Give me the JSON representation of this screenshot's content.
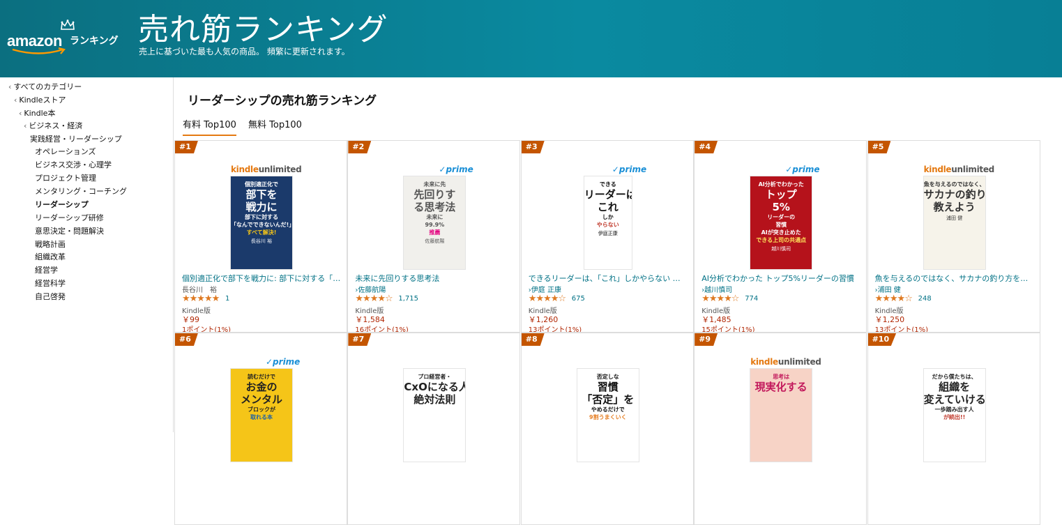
{
  "header": {
    "logo_brand": "amazon",
    "logo_label": "ランキング",
    "title": "売れ筋ランキング",
    "subtitle": "売上に基づいた最も人気の商品。 頻繁に更新されます。"
  },
  "sidebar": {
    "items": [
      {
        "label": "すべてのカテゴリー",
        "chev": "‹"
      },
      {
        "label": "Kindleストア",
        "chev": "‹"
      },
      {
        "label": "Kindle本",
        "chev": "‹"
      },
      {
        "label": "ビジネス・経済",
        "chev": "‹"
      },
      {
        "label": "実践経営・リーダーシップ"
      },
      {
        "label": "オペレーションズ"
      },
      {
        "label": "ビジネス交渉・心理学"
      },
      {
        "label": "プロジェクト管理"
      },
      {
        "label": "メンタリング・コーチング"
      },
      {
        "label": "リーダーシップ"
      },
      {
        "label": "リーダーシップ研修"
      },
      {
        "label": "意思決定・問題解決"
      },
      {
        "label": "戦略計画"
      },
      {
        "label": "組織改革"
      },
      {
        "label": "経営学"
      },
      {
        "label": "経営科学"
      },
      {
        "label": "自己啓発"
      }
    ]
  },
  "main": {
    "title": "リーダーシップの売れ筋ランキング",
    "tabs": [
      "有料 Top100",
      "無料 Top100"
    ]
  },
  "products": [
    {
      "rank": "#1",
      "badge": "kindleunlimited",
      "ku_k": "kindle",
      "ku_u": "unlimited",
      "title": "個別適正化で部下を戦力に: 部下に対する「なんでできないんだ!」すべて解決!",
      "author": "長谷川　裕",
      "stars": "★★★★★",
      "reviews": "1",
      "format": "Kindle版",
      "price": "￥99",
      "points": "1ポイント(1%)",
      "cover_text": [
        "個別適正化で",
        "部下を",
        "戦力に",
        "部下に対する",
        "「なんでできないんだ!」",
        "すべて解決!"
      ],
      "cover_author": "長谷川 裕"
    },
    {
      "rank": "#2",
      "badge": "prime",
      "prime": "✓prime",
      "title": "未来に先回りする思考法",
      "author": "›佐藤航陽",
      "stars": "★★★★☆",
      "reviews": "1,715",
      "format": "Kindle版",
      "price": "￥1,584",
      "points": "16ポイント(1%)",
      "cover_text": [
        "未来に先",
        "先回りす",
        "る思考法",
        "未来に",
        "99.9%",
        "推薦"
      ],
      "cover_author": "佐藤航陽"
    },
    {
      "rank": "#3",
      "badge": "prime",
      "prime": "✓prime",
      "title": "できるリーダーは、「これ」しかやらない メンバーが自ら動き出す「任せ方」のコツ",
      "author": "›伊庭 正康",
      "stars": "★★★★☆",
      "reviews": "675",
      "format": "Kindle版",
      "price": "￥1,260",
      "points": "13ポイント(1%)",
      "cover_text": [
        "できる",
        "リーダーは、",
        "これ",
        "しか",
        "やらない"
      ],
      "cover_author": "伊庭正康"
    },
    {
      "rank": "#4",
      "badge": "prime",
      "prime": "✓prime",
      "title": "AI分析でわかった トップ5%リーダーの習慣",
      "author": "›越川慎司",
      "stars": "★★★★☆",
      "reviews": "774",
      "format": "Kindle版",
      "price": "￥1,485",
      "points": "15ポイント(1%)",
      "cover_text": [
        "AI分析でわかった",
        "トップ",
        "5%",
        "リーダーの",
        "習慣",
        "AIが突き止めた",
        "できる上司の共通点"
      ],
      "cover_author": "越川慎司"
    },
    {
      "rank": "#5",
      "badge": "kindleunlimited",
      "ku_k": "kindle",
      "ku_u": "unlimited",
      "title": "魚を与えるのではなく、サカナの釣り方を教えよう",
      "author": "›浦田 健",
      "stars": "★★★★☆",
      "reviews": "248",
      "format": "Kindle版",
      "price": "￥1,250",
      "points": "13ポイント(1%)",
      "cover_text": [
        "魚を与えるのではなく、",
        "サカナの釣り方を",
        "教えよう"
      ],
      "cover_author": "浦田 健"
    },
    {
      "rank": "#6",
      "badge": "prime",
      "prime": "✓prime",
      "cover_text": [
        "読むだけで",
        "お金の",
        "メンタル",
        "ブロックが",
        "取れる本"
      ]
    },
    {
      "rank": "#7",
      "badge": "none",
      "cover_text": [
        "プロ経営者・",
        "CxOになる人の",
        "絶対法則"
      ]
    },
    {
      "rank": "#8",
      "badge": "none",
      "cover_text": [
        "否定しな",
        "習慣",
        "「否定」を",
        "やめるだけで",
        "9割うまくいく"
      ]
    },
    {
      "rank": "#9",
      "badge": "kindleunlimited",
      "ku_k": "kindle",
      "ku_u": "unlimited",
      "cover_text": [
        "思考は",
        "現実化する"
      ]
    },
    {
      "rank": "#10",
      "badge": "none",
      "cover_text": [
        "だから僕たちは、",
        "組織を",
        "変えていける",
        "一歩踏み出す人",
        "が続出!!"
      ]
    }
  ],
  "colors": {
    "header": "#0a8aa0",
    "badge": "#c45500",
    "link": "#007185",
    "price": "#b12704",
    "star": "#de7921",
    "tab_underline": "#e47911"
  }
}
